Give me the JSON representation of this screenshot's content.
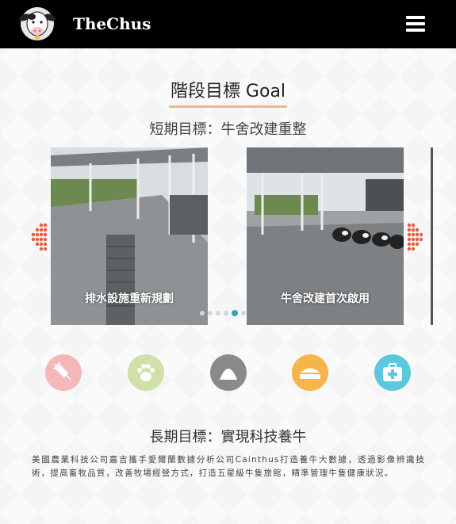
{
  "navbar": {
    "brand": "TheChus",
    "logo_icon": "cow-logo-icon",
    "menu_icon": "hamburger-menu-icon"
  },
  "section": {
    "title": "階段目標 Goal",
    "underline_color": "#f2b58b"
  },
  "short_term": {
    "title": "短期目標：牛舍改建重整",
    "slides": [
      {
        "caption": "排水設施重新規劃"
      },
      {
        "caption": "牛舍改建首次啟用"
      }
    ],
    "carousel": {
      "dot_count": 6,
      "active_index": 4,
      "active_color": "#2aa8c2",
      "arrow_color": "#e85d3a"
    }
  },
  "features": [
    {
      "icon": "syringe-icon",
      "color": "#f4b8b8"
    },
    {
      "icon": "paw-icon",
      "color": "#cfe0a8"
    },
    {
      "icon": "feed-pile-icon",
      "color": "#8a8a8a"
    },
    {
      "icon": "feed-tray-icon",
      "color": "#f5b54a"
    },
    {
      "icon": "medical-kit-icon",
      "color": "#5cc8dc"
    }
  ],
  "long_term": {
    "title": "長期目標：實現科技養牛",
    "paragraph": "美國農業科技公司嘉吉攜手愛爾蘭數據分析公司Cainthus打造養牛大數據，透過影像辨識技術，提高畜牧品質，改善牧場經營方式，打造五星級牛隻旅館，精準管理牛隻健康狀況。"
  }
}
